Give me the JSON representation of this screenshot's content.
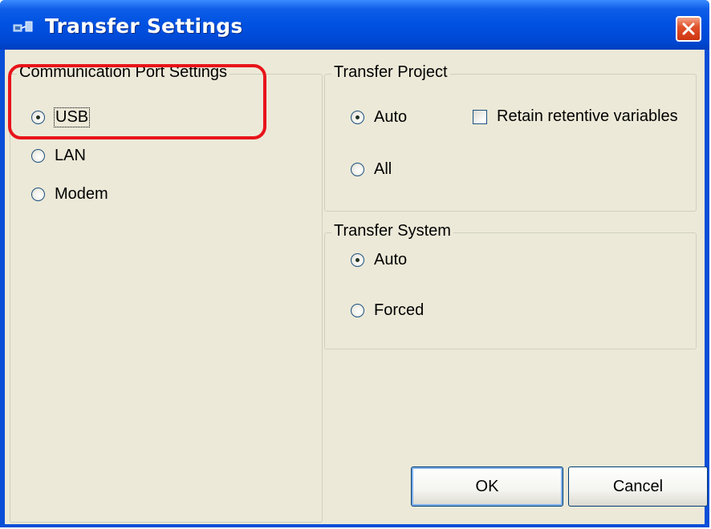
{
  "window": {
    "title": "Transfer Settings",
    "accent": "#0052e2",
    "close_color": "#e0532c"
  },
  "comm_port": {
    "legend": "Communication Port Settings",
    "options": [
      {
        "label": "USB",
        "checked": true
      },
      {
        "label": "LAN",
        "checked": false
      },
      {
        "label": "Modem",
        "checked": false
      }
    ]
  },
  "transfer_project": {
    "legend": "Transfer Project",
    "options": [
      {
        "label": "Auto",
        "checked": true
      },
      {
        "label": "All",
        "checked": false
      }
    ],
    "retain_label": "Retain retentive variables",
    "retain_checked": false
  },
  "transfer_system": {
    "legend": "Transfer System",
    "options": [
      {
        "label": "Auto",
        "checked": true
      },
      {
        "label": "Forced",
        "checked": false
      }
    ]
  },
  "buttons": {
    "ok_label": "OK",
    "cancel_label": "Cancel"
  },
  "highlight_color": "#e8141a"
}
